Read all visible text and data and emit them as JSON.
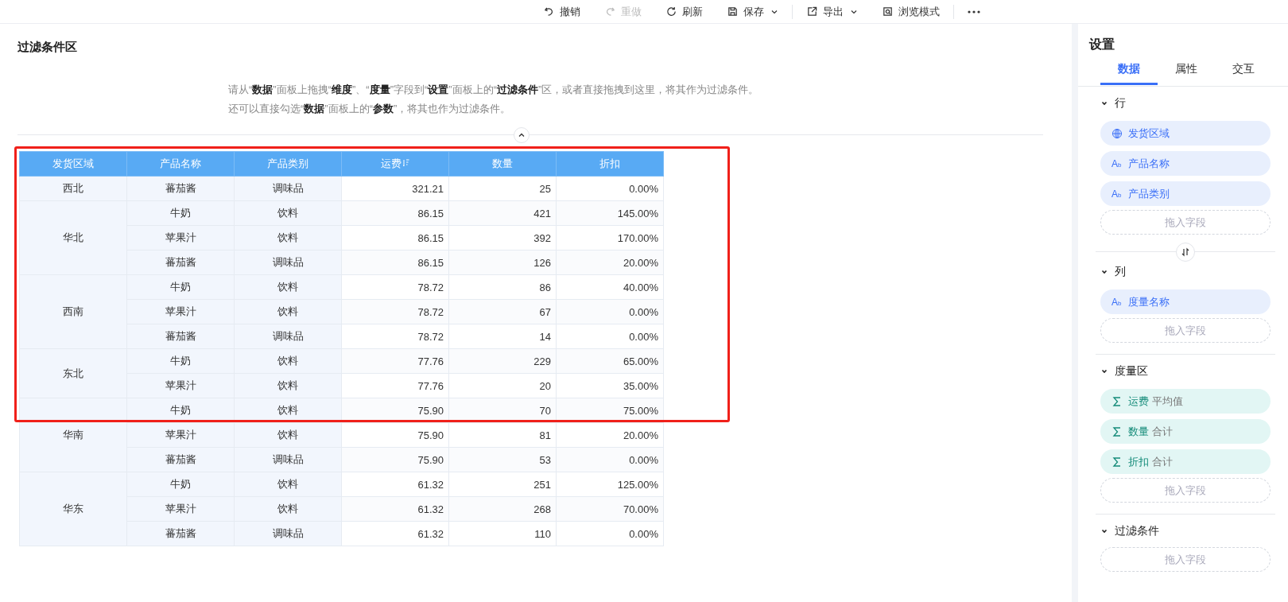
{
  "toolbar": [
    {
      "kind": "undo",
      "label": "撤销",
      "disabled": false,
      "dropdown": false
    },
    {
      "kind": "redo",
      "label": "重做",
      "disabled": true,
      "dropdown": false
    },
    {
      "kind": "refresh",
      "label": "刷新",
      "disabled": false,
      "dropdown": false
    },
    {
      "kind": "save",
      "label": "保存",
      "disabled": false,
      "dropdown": true
    },
    {
      "kind": "export",
      "label": "导出",
      "disabled": false,
      "dropdown": true
    },
    {
      "kind": "preview",
      "label": "浏览模式",
      "disabled": false,
      "dropdown": false
    }
  ],
  "filter_area": {
    "title": "过滤条件区",
    "hint_lines": [
      "请从“**数据**”面板上拖拽“**维度**”、“**度量**”字段到“**设置**”面板上的“**过滤条件**”区，或者直接拖拽到这里，将其作为过滤条件。",
      "还可以直接勾选“**数据**”面板上的“**参数**”，将其也作为过滤条件。"
    ]
  },
  "table": {
    "columns": [
      "发货区域",
      "产品名称",
      "产品类别",
      "运费",
      "数量",
      "折扣"
    ],
    "groups": [
      {
        "region": "西北",
        "rows": [
          [
            "蕃茄酱",
            "调味品",
            "321.21",
            "25",
            "0.00%"
          ]
        ]
      },
      {
        "region": "华北",
        "rows": [
          [
            "牛奶",
            "饮料",
            "86.15",
            "421",
            "145.00%"
          ],
          [
            "苹果汁",
            "饮料",
            "86.15",
            "392",
            "170.00%"
          ],
          [
            "蕃茄酱",
            "调味品",
            "86.15",
            "126",
            "20.00%"
          ]
        ]
      },
      {
        "region": "西南",
        "rows": [
          [
            "牛奶",
            "饮料",
            "78.72",
            "86",
            "40.00%"
          ],
          [
            "苹果汁",
            "饮料",
            "78.72",
            "67",
            "0.00%"
          ],
          [
            "蕃茄酱",
            "调味品",
            "78.72",
            "14",
            "0.00%"
          ]
        ]
      },
      {
        "region": "东北",
        "rows": [
          [
            "牛奶",
            "饮料",
            "77.76",
            "229",
            "65.00%"
          ],
          [
            "苹果汁",
            "饮料",
            "77.76",
            "20",
            "35.00%"
          ]
        ]
      },
      {
        "region": "华南",
        "rows": [
          [
            "牛奶",
            "饮料",
            "75.90",
            "70",
            "75.00%"
          ],
          [
            "苹果汁",
            "饮料",
            "75.90",
            "81",
            "20.00%"
          ],
          [
            "蕃茄酱",
            "调味品",
            "75.90",
            "53",
            "0.00%"
          ]
        ]
      },
      {
        "region": "华东",
        "rows": [
          [
            "牛奶",
            "饮料",
            "61.32",
            "251",
            "125.00%"
          ],
          [
            "苹果汁",
            "饮料",
            "61.32",
            "268",
            "70.00%"
          ],
          [
            "蕃茄酱",
            "调味品",
            "61.32",
            "110",
            "0.00%"
          ]
        ]
      }
    ]
  },
  "settings": {
    "title": "设置",
    "tabs": [
      {
        "label": "数据",
        "selected": true
      },
      {
        "label": "属性",
        "selected": false
      },
      {
        "label": "交互",
        "selected": false
      }
    ],
    "sections": [
      {
        "title": "行",
        "expanded": true,
        "fields": [
          {
            "kind": "geo",
            "name": "发货区域"
          },
          {
            "kind": "text",
            "icon": "A$_{b}$",
            "name": "产品名称"
          },
          {
            "kind": "text",
            "icon": "A$_{b}$",
            "name": "产品类别"
          }
        ],
        "dropzone": "拖入字段"
      },
      {
        "title": "列",
        "expanded": true,
        "fields": [
          {
            "kind": "text",
            "icon": "A$_{b}$",
            "name": "度量名称"
          }
        ],
        "dropzone": "拖入字段"
      },
      {
        "title": "度量区",
        "expanded": true,
        "fields": [
          {
            "kind": "measure",
            "name": "运费",
            "aggregate": "平均值"
          },
          {
            "kind": "measure",
            "name": "数量",
            "aggregate": "合计"
          },
          {
            "kind": "measure",
            "name": "折扣",
            "aggregate": "合计"
          }
        ],
        "dropzone": "拖入字段"
      },
      {
        "title": "过滤条件",
        "expanded": true,
        "dropzone": "拖入字段"
      }
    ]
  }
}
